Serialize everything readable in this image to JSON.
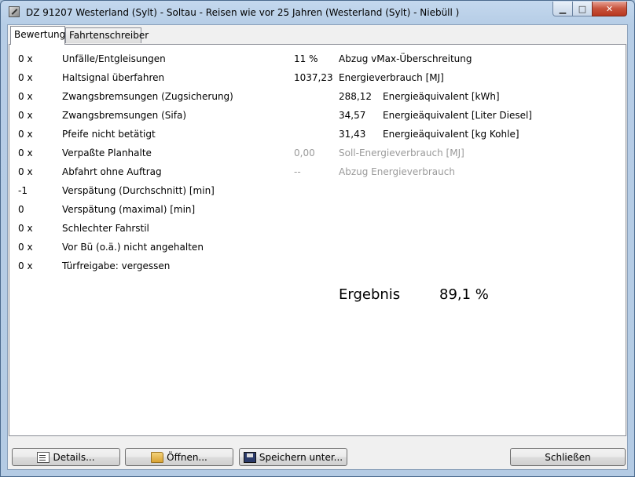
{
  "window": {
    "title": "DZ 91207 Westerland (Sylt) - Soltau - Reisen wie vor 25 Jahren (Westerland (Sylt) - Niebüll )",
    "minimize_glyph": "▁",
    "maximize_glyph": "□",
    "close_glyph": "✕"
  },
  "tabs": [
    {
      "label": "Bewertung",
      "active": true
    },
    {
      "label": "Fahrtenschreiber",
      "active": false
    }
  ],
  "penalties": [
    {
      "count": "0 x",
      "label": "Unfälle/Entgleisungen"
    },
    {
      "count": "0 x",
      "label": "Haltsignal überfahren"
    },
    {
      "count": "0 x",
      "label": "Zwangsbremsungen (Zugsicherung)"
    },
    {
      "count": "0 x",
      "label": "Zwangsbremsungen (Sifa)"
    },
    {
      "count": "0 x",
      "label": "Pfeife nicht betätigt"
    },
    {
      "count": "0 x",
      "label": "Verpaßte Planhalte"
    },
    {
      "count": "0 x",
      "label": "Abfahrt ohne Auftrag"
    },
    {
      "count": "-1",
      "label": "Verspätung (Durchschnitt) [min]"
    },
    {
      "count": "0",
      "label": "Verspätung (maximal) [min]"
    },
    {
      "count": "0 x",
      "label": "Schlechter Fahrstil"
    },
    {
      "count": "0 x",
      "label": "Vor Bü (o.ä.) nicht angehalten"
    },
    {
      "count": "0 x",
      "label": "Türfreigabe: vergessen"
    }
  ],
  "energy": {
    "vmax_value": "11 %",
    "vmax_label": "Abzug vMax-Überschreitung",
    "consumption_value": "1037,23",
    "consumption_label": "Energieverbrauch [MJ]",
    "equivalents": [
      {
        "value": "288,12",
        "label": "Energieäquivalent [kWh]"
      },
      {
        "value": "34,57",
        "label": "Energieäquivalent [Liter Diesel]"
      },
      {
        "value": "31,43",
        "label": "Energieäquivalent [kg Kohle]"
      }
    ],
    "target_value": "0,00",
    "target_label": "Soll-Energieverbrauch [MJ]",
    "deduction_value": "--",
    "deduction_label": "Abzug Energieverbrauch"
  },
  "result": {
    "label": "Ergebnis",
    "value": "89,1 %"
  },
  "buttons": {
    "details": "Details...",
    "open": "Öffnen...",
    "save": "Speichern unter...",
    "close": "Schließen"
  },
  "icons": {
    "app": "app-icon",
    "details": "details-icon",
    "open": "folder-open-icon",
    "save": "floppy-disk-icon"
  }
}
